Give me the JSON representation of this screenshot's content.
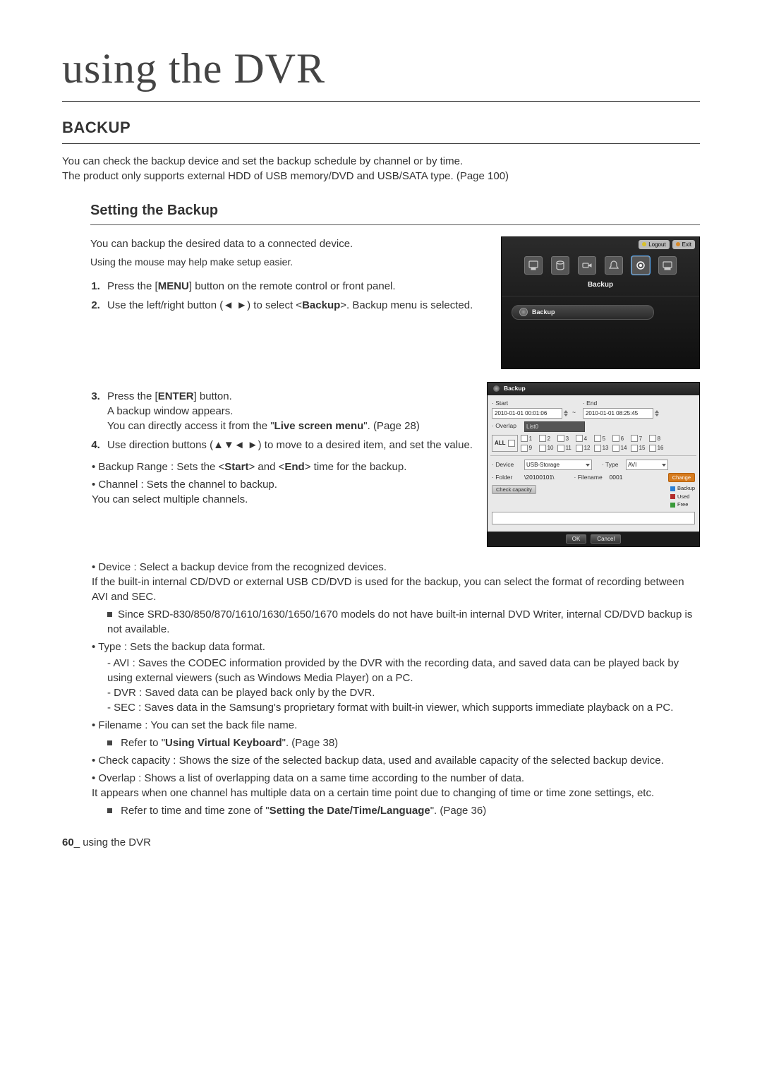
{
  "page_header": "using the DVR",
  "section_title": "BACKUP",
  "intro_lines": [
    "You can check the backup device and set the backup schedule by channel or by time.",
    "The product only supports external HDD of USB memory/DVD and USB/SATA type. (Page 100)"
  ],
  "sub_title": "Setting the Backup",
  "sub_intro": "You can backup the desired data to a connected device.",
  "mouse_note": "Using the mouse may help make setup easier.",
  "steps_a": [
    {
      "pre": "Press the [",
      "k": "MENU",
      "post": "] button on the remote control or front panel."
    },
    {
      "pre": "Use the left/right button (◄ ►) to select <",
      "k": "Backup",
      "post": ">. Backup menu is selected."
    }
  ],
  "steps_b": [
    {
      "pre": "Press the [",
      "k": "ENTER",
      "post": "] button.",
      "more_plain": "A backup window appears.",
      "more_pre": "You can directly access it from the \"",
      "more_k": "Live screen menu",
      "more_post": "\". (Page 28)"
    },
    {
      "pre": "Use direction buttons (▲▼◄ ►) to move to a desired item, and set the value.",
      "k": "",
      "post": ""
    }
  ],
  "bullets_b": [
    {
      "pre": "Backup Range : Sets the <",
      "k1": "Start",
      "mid": "> and <",
      "k2": "End",
      "post": "> time for the backup."
    },
    {
      "plain": "Channel : Sets the channel to backup.",
      "sub_plain": "You can select multiple channels."
    }
  ],
  "bullets_full": {
    "device": "Device : Select a backup device from the recognized devices.",
    "device_sub": "If the built-in internal CD/DVD or external USB CD/DVD is used for the backup, you can select the format of recording between AVI and SEC.",
    "device_note": "Since SRD-830/850/870/1610/1630/1650/1670 models do not have built-in internal DVD Writer, internal CD/DVD backup is not available.",
    "type": "Type : Sets the backup data format.",
    "type_items": [
      "AVI : Saves the CODEC information provided by the DVR with the recording data, and saved data can be played back by using external viewers (such as Windows Media Player) on a PC.",
      "DVR : Saved data can be played back only by the DVR.",
      "SEC : Saves data in the Samsung's proprietary format with built-in viewer, which supports immediate playback on a PC."
    ],
    "filename": "Filename : You can set the back file name.",
    "filename_note_pre": "Refer to \"",
    "filename_note_k": "Using Virtual Keyboard",
    "filename_note_post": "\". (Page 38)",
    "checkcap": "Check capacity : Shows the size of the selected backup data, used and available capacity of the selected backup device.",
    "overlap": "Overlap : Shows a list of overlapping data on a same time according to the number of data.",
    "overlap_sub": "It appears when one channel has multiple data on a certain time point due to changing of time or time zone settings, etc.",
    "overlap_note_pre": "Refer to time and time zone of \"",
    "overlap_note_k": "Setting the Date/Time/Language",
    "overlap_note_post": "\". (Page 36)"
  },
  "footer": {
    "page": "60",
    "text": "_ using the DVR"
  },
  "fig1": {
    "logout": "Logout",
    "exit": "Exit",
    "tab_label": "Backup",
    "submenu": "Backup"
  },
  "fig2": {
    "title": "Backup",
    "labels": {
      "start": "· Start",
      "end": "· End",
      "overlap": "· Overlap",
      "device": "· Device",
      "type": "· Type",
      "folder": "· Folder",
      "filename": "· Filename"
    },
    "start_v": "2010-01-01 00:01:06",
    "end_v": "2010-01-01 08:25:45",
    "overlap_v": "List0",
    "all": "ALL",
    "channels": {
      "row1": [
        "1",
        "2",
        "3",
        "4",
        "5",
        "6",
        "7",
        "8"
      ],
      "row2": [
        "9",
        "10",
        "11",
        "12",
        "13",
        "14",
        "15",
        "16"
      ]
    },
    "device_v": "USB-Storage",
    "type_v": "AVI",
    "folder_v": "\\20100101\\",
    "filename_v": "0001",
    "change": "Change",
    "checkcap": "Check capacity",
    "legend": {
      "backup": "Backup",
      "used": "Used",
      "free": "Free"
    },
    "ok": "OK",
    "cancel": "Cancel",
    "colors": {
      "backup": "#2a7fd4",
      "used": "#b22d2d",
      "free": "#3a9a3a"
    }
  }
}
